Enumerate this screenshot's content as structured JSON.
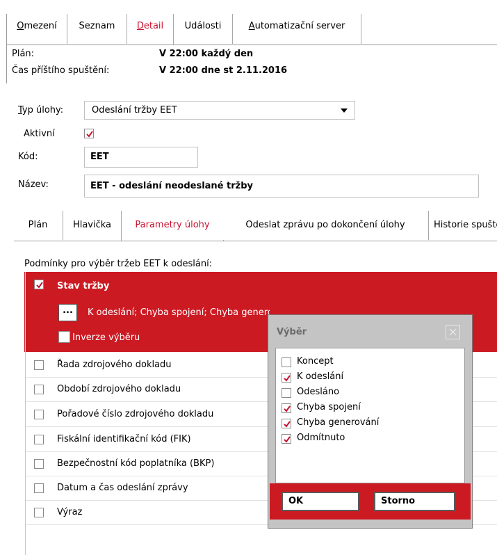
{
  "top_tabs": [
    {
      "label": "Omezení"
    },
    {
      "label": "Seznam"
    },
    {
      "label": "Detail"
    },
    {
      "label": "Události"
    },
    {
      "label": "Automatizační server"
    }
  ],
  "info": {
    "plan_label": "Plán:",
    "plan_value": "V 22:00 každý den",
    "next_label": "Čas příštího spuštění:",
    "next_value": "V 22:00 dne st 2.11.2016"
  },
  "form": {
    "type_label": "Typ úlohy:",
    "type_value": "Odeslání tržby EET",
    "active_label": "Aktivní",
    "active_checked": true,
    "code_label": "Kód:",
    "code_value": "EET",
    "name_label": "Název:",
    "name_value": "EET - odeslání neodeslané tržby"
  },
  "lower_tabs": [
    {
      "label": "Plán"
    },
    {
      "label": "Hlavička"
    },
    {
      "label": "Parametry úlohy"
    },
    {
      "label": "Odeslat zprávu po dokončení úlohy"
    },
    {
      "label": "Historie spuštění"
    }
  ],
  "conditions": {
    "heading": "Podmínky pro výběr tržeb EET k odeslání:",
    "selected": {
      "label": "Stav tržby",
      "checked": true,
      "button_label": "...",
      "value_text": "K odeslání; Chyba spojení; Chyba generování; Odmítnuto",
      "invert_label": "Inverze výběru"
    },
    "items": [
      {
        "label": "Řada zdrojového dokladu"
      },
      {
        "label": "Období zdrojového dokladu"
      },
      {
        "label": "Pořadové číslo zdrojového dokladu"
      },
      {
        "label": "Fiskální identifikační kód (FIK)"
      },
      {
        "label": "Bezpečnostní kód poplatníka (BKP)"
      },
      {
        "label": "Datum a čas odeslání zprávy"
      },
      {
        "label": "Výraz"
      }
    ]
  },
  "dialog": {
    "title": "Výběr",
    "options": [
      {
        "label": "Koncept",
        "checked": false
      },
      {
        "label": "K odeslání",
        "checked": true
      },
      {
        "label": "Odesláno",
        "checked": false
      },
      {
        "label": "Chyba spojení",
        "checked": true
      },
      {
        "label": "Chyba generování",
        "checked": true
      },
      {
        "label": "Odmítnuto",
        "checked": true
      }
    ],
    "ok_label": "OK",
    "cancel_label": "Storno"
  },
  "colors": {
    "accent": "#cc1a23",
    "check": "#c8102e"
  }
}
